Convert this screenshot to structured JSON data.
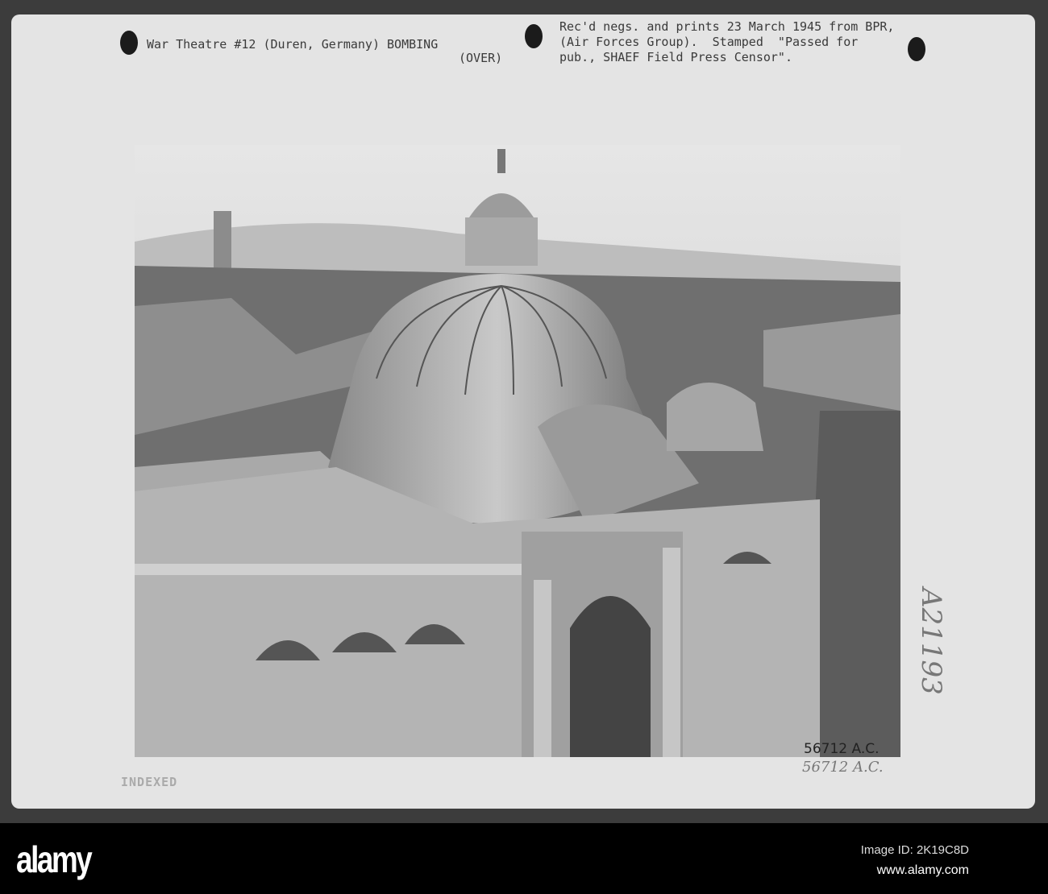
{
  "caption": {
    "left_line": "War Theatre #12 (Duren, Germany) BOMBING",
    "over": "(OVER)",
    "right_lines": [
      "Rec'd negs. and prints 23 March 1945 from BPR,",
      "(Air Forces Group).  Stamped  \"Passed for",
      "pub., SHAEF Field Press Censor\"."
    ]
  },
  "photo_number_printed": "56712 A.C.",
  "photo_number_handwritten": "56712 A.C.",
  "handwritten_side_id": "A21193",
  "stamp": "INDEXED",
  "footer": {
    "logo": "alamy",
    "image_id": "Image ID: 2K19C8D",
    "url": "www.alamy.com"
  }
}
